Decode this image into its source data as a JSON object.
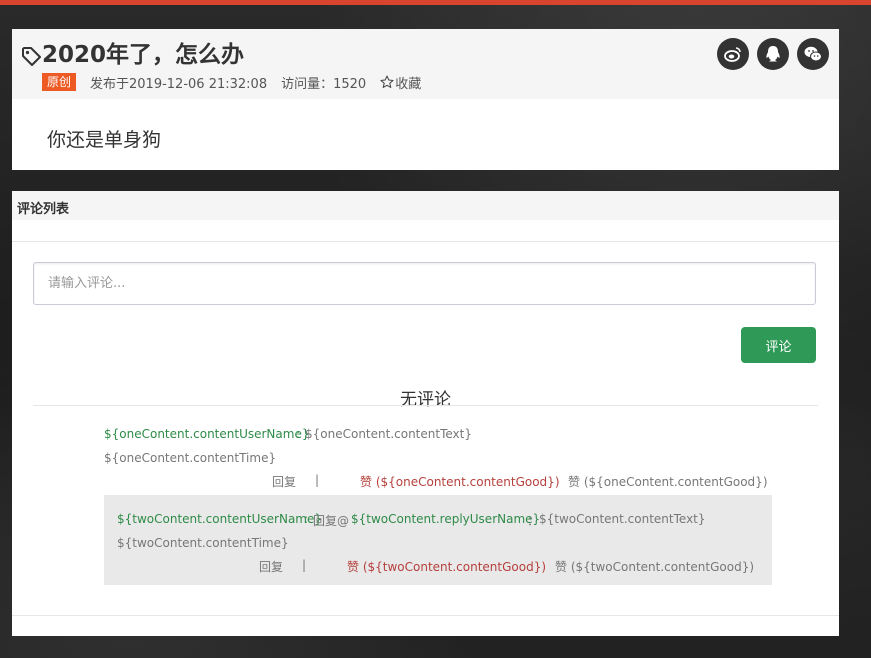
{
  "post": {
    "title": "2020年了，怎么办",
    "badge": "原创",
    "published": "发布于2019-12-06 21:32:08",
    "views": "访问量：1520",
    "favorite": "收藏",
    "content": "你还是单身狗",
    "share_icons": [
      "weibo-icon",
      "qq-icon",
      "wechat-icon"
    ]
  },
  "comments": {
    "title": "评论列表",
    "input_placeholder": "请输入评论...",
    "submit_label": "评论",
    "empty_text": "无评论",
    "item": {
      "user": "${oneContent.contentUserName}",
      "sep": ":",
      "text": "${oneContent.contentText}",
      "time": "${oneContent.contentTime}",
      "reply_label": "回复",
      "pipe": "|",
      "like_active": "赞 (${oneContent.contentGood})",
      "like_inactive": "赞 (${oneContent.contentGood})"
    },
    "reply": {
      "user": "${twoContent.contentUserName}",
      "sep": ":",
      "reply_prefix": "回复@",
      "reply_user": "${twoContent.replyUserName}",
      "sep2": "：",
      "text": "${twoContent.contentText}",
      "time": "${twoContent.contentTime}",
      "reply_label": "回复",
      "pipe": "|",
      "like_active": "赞 (${twoContent.contentGood})",
      "like_inactive": "赞 (${twoContent.contentGood})"
    }
  },
  "colors": {
    "accent_top": "#d9442e",
    "badge": "#ee5a24",
    "button": "#2f9a57",
    "username": "#2e8b47",
    "like": "#b5403c"
  }
}
